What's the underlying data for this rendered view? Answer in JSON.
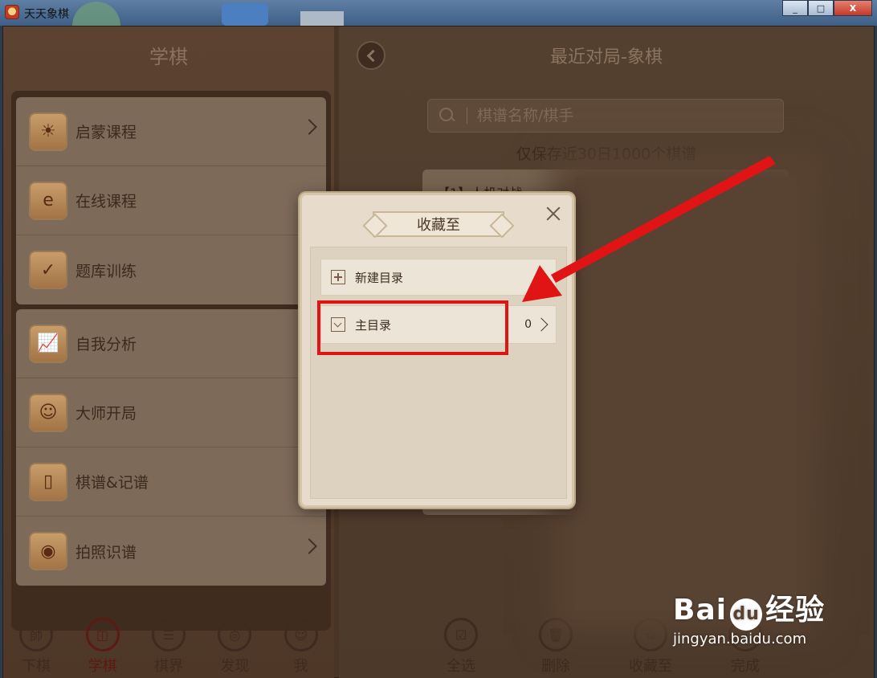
{
  "window": {
    "title": "天天象棋",
    "controls": {
      "minimize": "_",
      "maximize": "□",
      "close": "X"
    }
  },
  "left": {
    "header": "学棋",
    "group1": [
      {
        "label": "启蒙课程",
        "icon": "lightbulb-icon",
        "glyph": "☀",
        "chevron": true
      },
      {
        "label": "在线课程",
        "icon": "ie-icon",
        "glyph": "e",
        "chevron": false
      },
      {
        "label": "题库训练",
        "icon": "checklist-icon",
        "glyph": "✓",
        "chevron": false
      }
    ],
    "group2": [
      {
        "label": "自我分析",
        "icon": "analysis-chart-icon",
        "glyph": "📈",
        "chevron": false
      },
      {
        "label": "大师开局",
        "icon": "master-avatar-icon",
        "glyph": "☺",
        "chevron": false
      },
      {
        "label": "棋谱&记谱",
        "icon": "notebook-icon",
        "glyph": "▯",
        "chevron": false
      },
      {
        "label": "拍照识谱",
        "icon": "camera-icon",
        "glyph": "◉",
        "chevron": true
      }
    ],
    "bottom_nav": [
      {
        "label": "下棋",
        "glyph": "帥",
        "active": false
      },
      {
        "label": "学棋",
        "glyph": "◫",
        "active": true
      },
      {
        "label": "棋界",
        "glyph": "☰",
        "active": false
      },
      {
        "label": "发现",
        "glyph": "◎",
        "active": false
      },
      {
        "label": "我",
        "glyph": "☺",
        "active": false
      }
    ]
  },
  "right": {
    "title": "最近对局-象棋",
    "search_placeholder": "棋谱名称/棋手",
    "save_notice": "仅保存近30日1000个棋谱",
    "game_title": "【1】人机对战",
    "actions": [
      {
        "label": "全选",
        "glyph": "☑"
      },
      {
        "label": "删除",
        "glyph": "🗑"
      },
      {
        "label": "收藏至",
        "glyph": "☆"
      },
      {
        "label": "完成",
        "glyph": "✓"
      }
    ]
  },
  "dialog": {
    "title": "收藏至",
    "new_dir_label": "新建目录",
    "main_dir_label": "主目录",
    "main_dir_count": "0"
  },
  "annotation": {
    "arrow_color": "#e01414",
    "highlight_color": "#e01414"
  },
  "watermark": {
    "logo_left": "Bai",
    "logo_mid": "du",
    "logo_right": "经验",
    "sub": "jingyan.baidu.com"
  }
}
